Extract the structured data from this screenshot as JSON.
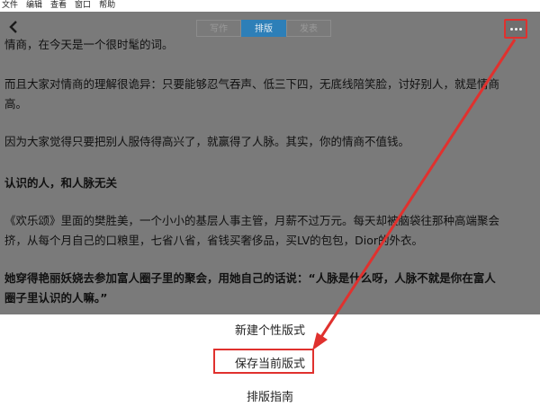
{
  "menubar": [
    "文件",
    "编辑",
    "查看",
    "窗口",
    "帮助"
  ],
  "toolbar": {
    "tabs": [
      {
        "label": "写作",
        "active": false
      },
      {
        "label": "排版",
        "active": true
      },
      {
        "label": "发表",
        "active": false
      }
    ]
  },
  "article": {
    "paragraphs": [
      "情商，在今天是一个很时髦的词。",
      "而且大家对情商的理解很诡异：只要能够忍气吞声、低三下四，无底线陪笑脸，讨好别人，就是情商",
      "高。",
      "因为大家觉得只要把别人服侍得高兴了，就赢得了人脉。其实，你的情商不值钱。",
      "认识的人，和人脉无关",
      "《欢乐颂》里面的樊胜美，一个小小的基层人事主管，月薪不过万元。每天却被脑袋往那种高端聚会",
      "挤，从每个月自己的口粮里，七省八省，省钱买奢侈品，买LV的包包，Dior的外衣。",
      "她穿得艳丽妖娆去参加富人圈子里的聚会，用她自己的话说：“人脉是什么呀，人脉不就是你在富人",
      "圈子里认识的人嘛。”"
    ]
  },
  "sheet": {
    "options": [
      "新建个性版式",
      "保存当前版式",
      "排版指南"
    ]
  },
  "colors": {
    "accent": "#2d7fb8",
    "annotation": "#e0312e",
    "overlay": "#7a7a7a"
  }
}
